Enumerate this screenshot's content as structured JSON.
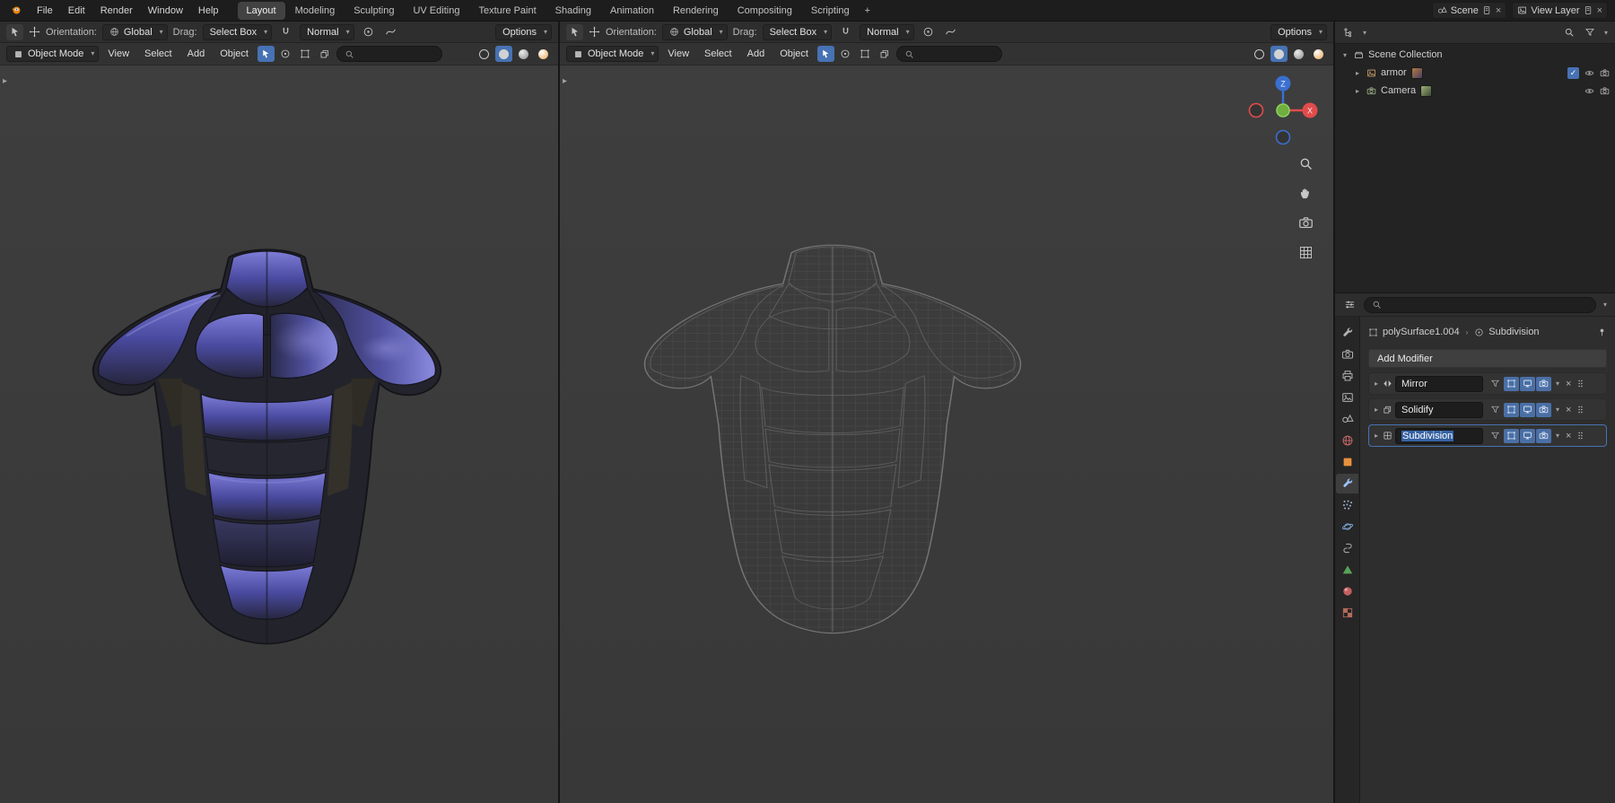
{
  "icons": {
    "chevron_down": "▾",
    "disclosure": "▸",
    "close": "×",
    "check": "✓",
    "breadcrumb_separator": "›",
    "panel_toggle": "▸",
    "add": "+"
  },
  "menubar": {
    "menus": [
      "File",
      "Edit",
      "Render",
      "Window",
      "Help"
    ],
    "tabs": [
      "Layout",
      "Modeling",
      "Sculpting",
      "UV Editing",
      "Texture Paint",
      "Shading",
      "Animation",
      "Rendering",
      "Compositing",
      "Scripting"
    ],
    "add_tab": "+",
    "scene": "Scene",
    "view_layer": "View Layer"
  },
  "tool_settings": {
    "orientation_label": "Orientation:",
    "orientation_value": "Global",
    "drag_label": "Drag:",
    "drag_value": "Select Box",
    "snap_value": "Normal",
    "options": "Options"
  },
  "viewport": {
    "mode": "Object Mode",
    "menus": [
      "View",
      "Select",
      "Add",
      "Object"
    ],
    "search_placeholder": ""
  },
  "gizmo": {
    "x_label": "X",
    "z_label": "Z"
  },
  "outliner": {
    "scene_collection": "Scene Collection",
    "items": [
      {
        "name": "armor"
      },
      {
        "name": "Camera"
      }
    ]
  },
  "properties": {
    "object_name": "polySurface1.004",
    "active_modifier": "Subdivision",
    "add_modifier_label": "Add Modifier",
    "modifiers": [
      {
        "name": "Mirror"
      },
      {
        "name": "Solidify"
      },
      {
        "name": "Subdivision"
      }
    ]
  },
  "colors": {
    "accent": "#4772b3",
    "axis_x": "#e24b4b",
    "axis_y": "#6fae3f",
    "axis_z": "#3b6fd0",
    "armor_purple": "#4a4aa0",
    "object_orange": "#e8913c",
    "data_green": "#56a357"
  }
}
